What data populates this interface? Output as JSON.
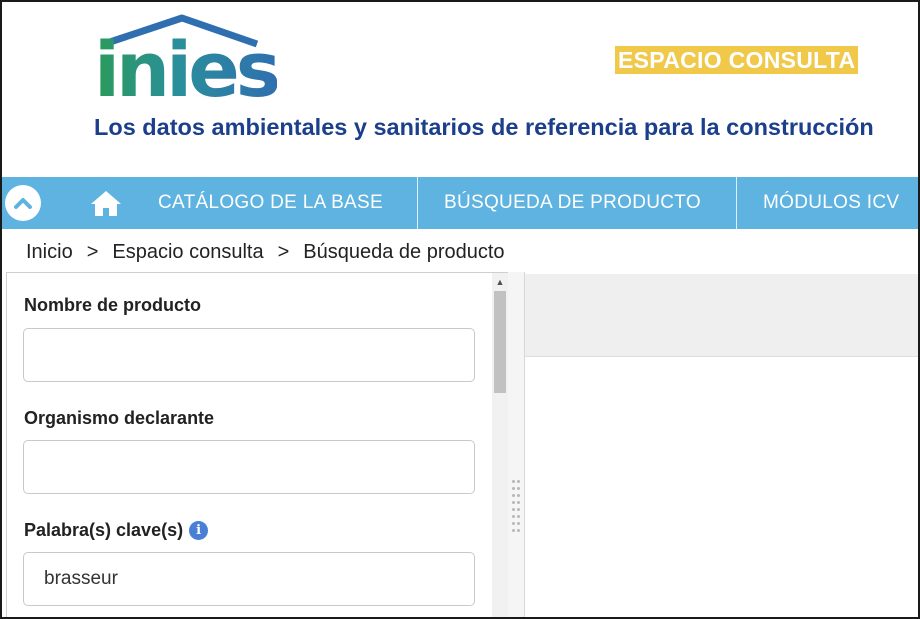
{
  "header": {
    "logo_text": "inies",
    "badge": "ESPACIO CONSULTA",
    "tagline": "Los datos ambientales y sanitarios de referencia para la construcción",
    "brand_colors": {
      "logo_green": "#2a9b5a",
      "logo_blue": "#2f6fb0",
      "badge_bg": "#f0c84a",
      "tagline": "#1b3f8b"
    }
  },
  "nav": {
    "background": "#5eb3e0",
    "toggle_icon": "chevron-up-icon",
    "home_icon": "home-icon",
    "items": [
      {
        "label": "CATÁLOGO DE LA BASE"
      },
      {
        "label": "BÚSQUEDA DE PRODUCTO"
      },
      {
        "label": "MÓDULOS ICV"
      }
    ]
  },
  "breadcrumb": {
    "separator": ">",
    "items": [
      "Inicio",
      "Espacio consulta",
      "Búsqueda de producto"
    ]
  },
  "form": {
    "fields": [
      {
        "label": "Nombre de producto",
        "value": ""
      },
      {
        "label": "Organismo declarante",
        "value": ""
      },
      {
        "label": "Palabra(s) clave(s)",
        "value": "brasseur",
        "info_icon": "info-icon"
      }
    ]
  }
}
